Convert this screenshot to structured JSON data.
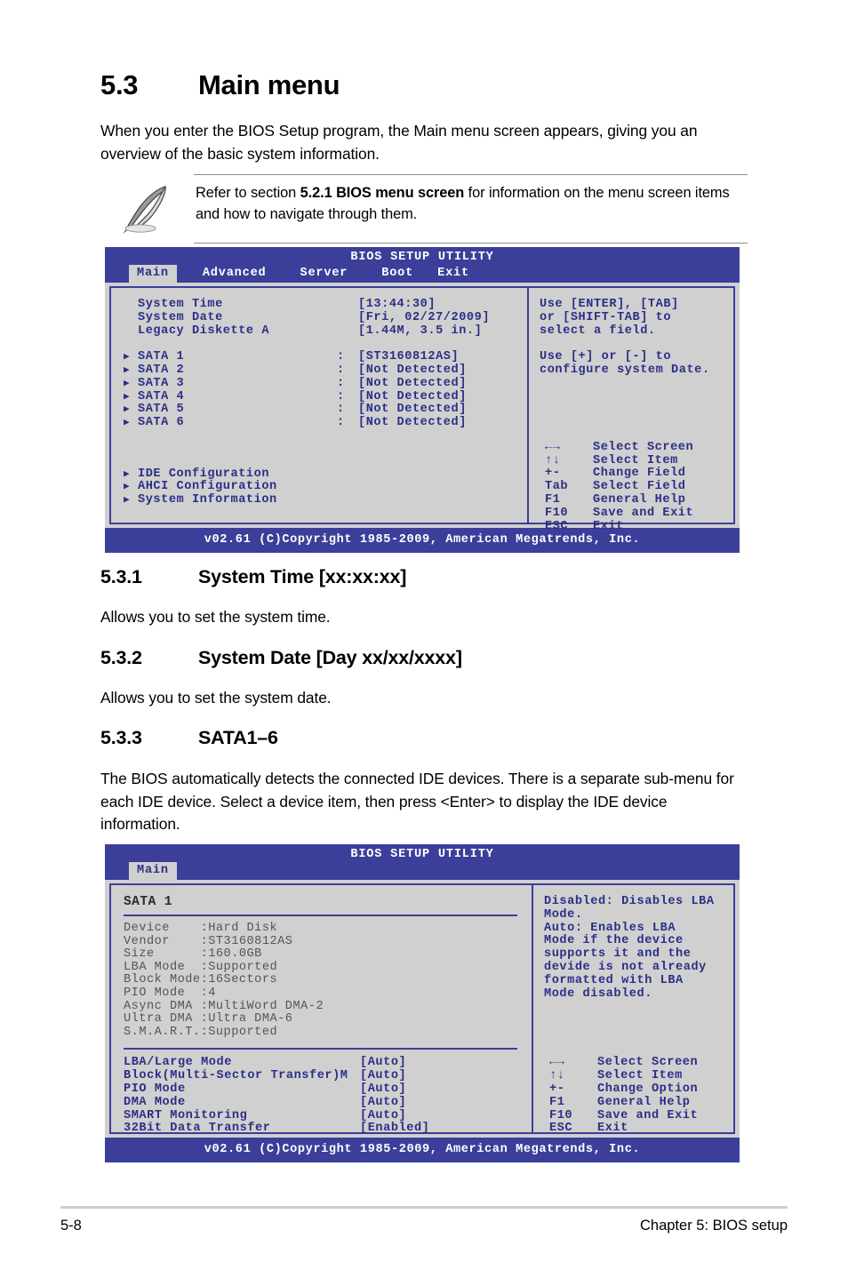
{
  "section": {
    "number": "5.3",
    "title": "Main menu",
    "intro": "When you enter the BIOS Setup program, the Main menu screen appears, giving you an overview of the basic system information."
  },
  "note": {
    "icon": "quill-pen-icon",
    "prefix": "Refer to section ",
    "bold": "5.2.1 BIOS menu screen",
    "suffix": " for information on the menu screen items and how to navigate through them."
  },
  "bios_main": {
    "title": "BIOS SETUP UTILITY",
    "tabs": [
      {
        "label": "Main",
        "active": true
      },
      {
        "label": "Advanced",
        "active": false
      },
      {
        "label": "Server",
        "active": false
      },
      {
        "label": "Boot",
        "active": false
      },
      {
        "label": "Exit",
        "active": false
      }
    ],
    "fields": [
      {
        "label": "System Time",
        "value": "[13:44:30]"
      },
      {
        "label": "System Date",
        "value": "[Fri, 02/27/2009]"
      },
      {
        "label": "Legacy Diskette A",
        "value": "[1.44M, 3.5 in.]"
      }
    ],
    "sata": [
      {
        "label": "SATA 1",
        "colon": ":",
        "value": "[ST3160812AS]"
      },
      {
        "label": "SATA 2",
        "colon": ":",
        "value": "[Not Detected]"
      },
      {
        "label": "SATA 3",
        "colon": ":",
        "value": "[Not Detected]"
      },
      {
        "label": "SATA 4",
        "colon": ":",
        "value": "[Not Detected]"
      },
      {
        "label": "SATA 5",
        "colon": ":",
        "value": "[Not Detected]"
      },
      {
        "label": "SATA 6",
        "colon": ":",
        "value": "[Not Detected]"
      }
    ],
    "submenus": [
      {
        "label": "IDE Configuration"
      },
      {
        "label": "AHCI Configuration"
      },
      {
        "label": "System Information"
      }
    ],
    "help_lines": [
      "Use [ENTER], [TAB]",
      "or [SHIFT-TAB] to",
      "select a field.",
      "",
      "Use [+] or [-] to",
      "configure system Date."
    ],
    "nav": [
      {
        "key": "←→",
        "desc": "Select Screen"
      },
      {
        "key": "↑↓",
        "desc": "Select Item"
      },
      {
        "key": "+-",
        "desc": "Change Field"
      },
      {
        "key": "Tab",
        "desc": "Select Field"
      },
      {
        "key": "F1",
        "desc": "General Help"
      },
      {
        "key": "F10",
        "desc": "Save and Exit"
      },
      {
        "key": "ESC",
        "desc": "Exit"
      }
    ],
    "footer": "v02.61 (C)Copyright 1985-2009, American Megatrends, Inc."
  },
  "sub_5_3_1": {
    "number": "5.3.1",
    "title": "System Time [xx:xx:xx]",
    "body": "Allows you to set the system time."
  },
  "sub_5_3_2": {
    "number": "5.3.2",
    "title": "System Date [Day xx/xx/xxxx]",
    "body": "Allows you to set the system date."
  },
  "sub_5_3_3": {
    "number": "5.3.3",
    "title": "SATA1–6",
    "body": "The BIOS automatically detects the connected IDE devices. There is a separate sub-menu for each IDE device. Select a device item, then press <Enter> to display the IDE device information."
  },
  "bios_sata": {
    "title": "BIOS SETUP UTILITY",
    "tabs": [
      {
        "label": "Main",
        "active": true
      }
    ],
    "panel_heading": "SATA 1",
    "device_info": [
      {
        "label": "Device    ",
        "value": ":Hard Disk"
      },
      {
        "label": "Vendor    ",
        "value": ":ST3160812AS"
      },
      {
        "label": "Size      ",
        "value": ":160.0GB"
      },
      {
        "label": "LBA Mode  ",
        "value": ":Supported"
      },
      {
        "label": "Block Mode",
        "value": ":16Sectors"
      },
      {
        "label": "PIO Mode  ",
        "value": ":4"
      },
      {
        "label": "Async DMA ",
        "value": ":MultiWord DMA-2"
      },
      {
        "label": "Ultra DMA ",
        "value": ":Ultra DMA-6"
      },
      {
        "label": "S.M.A.R.T.",
        "value": ":Supported"
      }
    ],
    "settings": [
      {
        "label": "LBA/Large Mode",
        "value": "[Auto]"
      },
      {
        "label": "Block(Multi-Sector Transfer)M",
        "value": "[Auto]"
      },
      {
        "label": "PIO Mode",
        "value": "[Auto]"
      },
      {
        "label": "DMA Mode",
        "value": "[Auto]"
      },
      {
        "label": "SMART Monitoring",
        "value": "[Auto]"
      },
      {
        "label": "32Bit Data Transfer",
        "value": "[Enabled]"
      }
    ],
    "help_lines": [
      "Disabled: Disables LBA",
      "Mode.",
      "Auto: Enables LBA",
      "Mode if the device",
      "supports it and the",
      "devide is not already",
      "formatted with LBA",
      "Mode disabled."
    ],
    "nav": [
      {
        "key": "←→",
        "desc": "Select Screen"
      },
      {
        "key": "↑↓",
        "desc": "Select Item"
      },
      {
        "key": "+-",
        "desc": "Change Option"
      },
      {
        "key": "F1",
        "desc": "General Help"
      },
      {
        "key": "F10",
        "desc": "Save and Exit"
      },
      {
        "key": "ESC",
        "desc": "Exit"
      }
    ],
    "footer": "v02.61 (C)Copyright 1985-2009, American Megatrends, Inc."
  },
  "page_footer": {
    "page_number": "5-8",
    "chapter": "Chapter 5: BIOS setup"
  },
  "colors": {
    "bios_blue": "#3b3f99",
    "bios_text_blue": "#2b2f86",
    "bios_bg": "#d0d0d0"
  }
}
